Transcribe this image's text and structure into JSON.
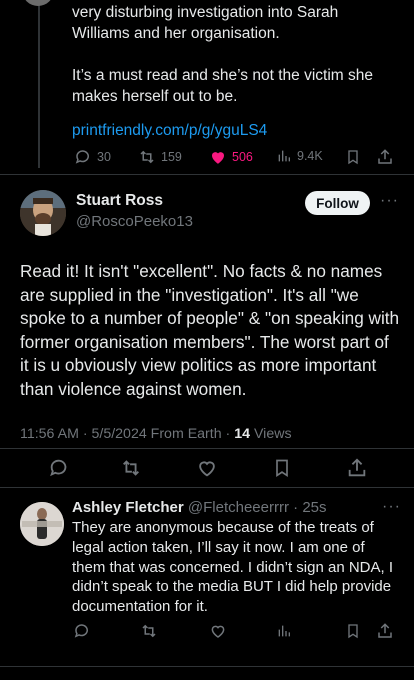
{
  "parent_tweet": {
    "text_line1": "very disturbing investigation into Sarah",
    "text_line2": "Williams and her organisation.",
    "text_line3": "It’s a must read and she’s not the victim she",
    "text_line4": "makes herself out to be.",
    "link": "printfriendly.com/p/g/yguLS4",
    "replies": "30",
    "reposts": "159",
    "likes": "506",
    "views": "9.4K"
  },
  "main_tweet": {
    "author_name": "Stuart Ross",
    "handle": "@RoscoPeeko13",
    "follow_label": "Follow",
    "more_label": "···",
    "text": "Read it! It isn't \"excellent\". No facts & no names are supplied in the \"investigation\".  It's all \"we spoke to a number of people\" & \"on speaking with former organisation members\".  The worst part of it is u obviously view politics as more important than violence against women.",
    "time": "11:56 AM · 5/5/2024 From Earth ·",
    "views_count": "14",
    "views_label": " Views"
  },
  "reply_tweet": {
    "author_name": "Ashley Fletcher",
    "handle": "@Fletcheeerrrr",
    "time": "· 25s",
    "more_label": "···",
    "text": "They are anonymous because of the treats of legal action taken, I’ll say it now. I am one of them that was concerned. I didn’t sign an NDA, I didn’t speak to the media BUT I did help provide documentation for it."
  },
  "colors": {
    "background": "#000000",
    "text": "#e7e9ea",
    "muted": "#71767b",
    "link": "#1d9bf0",
    "like": "#f91880"
  },
  "icons": [
    "reply-icon",
    "repost-icon",
    "like-icon",
    "views-icon",
    "bookmark-icon",
    "share-icon",
    "more-icon"
  ]
}
